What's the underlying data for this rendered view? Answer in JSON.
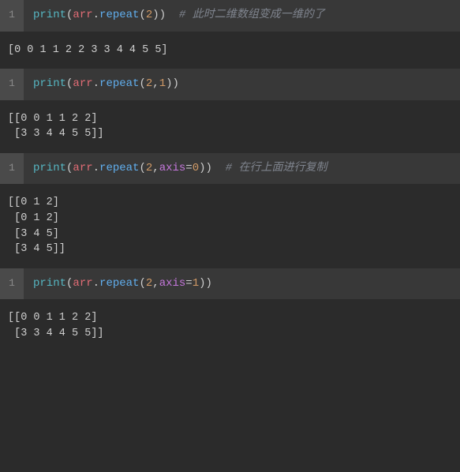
{
  "cells": [
    {
      "line_no": "1",
      "code": {
        "fn": "print",
        "id": "arr",
        "method": "repeat",
        "args_plain": "2",
        "args_kw": null,
        "comment": "# 此时二维数组变成一维的了"
      },
      "output": "[0 0 1 1 2 2 3 3 4 4 5 5]"
    },
    {
      "line_no": "1",
      "code": {
        "fn": "print",
        "id": "arr",
        "method": "repeat",
        "args_plain": "2,1",
        "args_kw": null,
        "comment": null
      },
      "output": "[[0 0 1 1 2 2]\n [3 3 4 4 5 5]]"
    },
    {
      "line_no": "1",
      "code": {
        "fn": "print",
        "id": "arr",
        "method": "repeat",
        "args_plain": "2",
        "args_kw": {
          "key": "axis",
          "val": "0"
        },
        "comment": "# 在行上面进行复制"
      },
      "output": "[[0 1 2]\n [0 1 2]\n [3 4 5]\n [3 4 5]]"
    },
    {
      "line_no": "1",
      "code": {
        "fn": "print",
        "id": "arr",
        "method": "repeat",
        "args_plain": "2",
        "args_kw": {
          "key": "axis",
          "val": "1"
        },
        "comment": null
      },
      "output": "[[0 0 1 1 2 2]\n [3 3 4 4 5 5]]"
    }
  ]
}
